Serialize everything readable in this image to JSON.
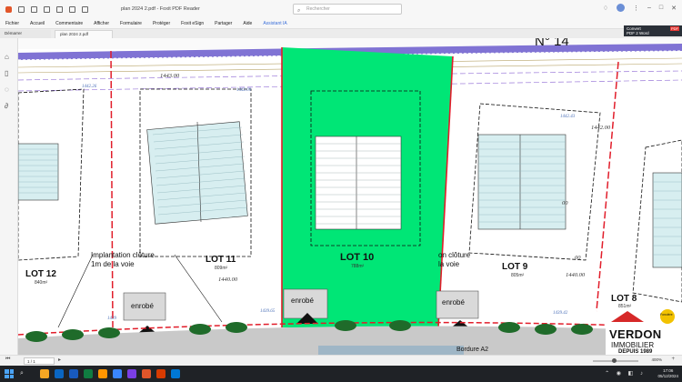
{
  "titlebar": {
    "title": "plan 2024 2.pdf - Foxit PDF Reader",
    "search_placeholder": "Rechercher"
  },
  "menu": [
    "Fichier",
    "Accueil",
    "Commentaire",
    "Afficher",
    "Formulaire",
    "Protéger",
    "Foxit eSign",
    "Partager",
    "Aide",
    "Assistant IA"
  ],
  "tabs": {
    "home": "Démarrer",
    "active": "plan 2024 2.pdf"
  },
  "convert_badge": {
    "line1": "Convert",
    "line2": "PDF 2 Word",
    "tag": "PDF"
  },
  "plan": {
    "street_number": "N° 14",
    "lots": [
      {
        "name": "LOT 12",
        "area": "840m²"
      },
      {
        "name": "LOT 11",
        "area": "809m²"
      },
      {
        "name": "LOT 10",
        "area": "788m²"
      },
      {
        "name": "LOT 9",
        "area": "805m²"
      },
      {
        "name": "LOT 8",
        "area": "851m²"
      }
    ],
    "fence_note_left_1": "Implantation clôture",
    "fence_note_left_2": "1m de la voie",
    "fence_note_right_1": "on clôture",
    "fence_note_right_2": "la voie",
    "enrobe": "enrobé",
    "bordure": "Bordure A2",
    "elevations": {
      "e1443_top": "1443.00",
      "e1442_right": "1442.00",
      "e1440_left": "1440.00",
      "e1440_right": "1440.00",
      "e1442_26": "1442.26",
      "e1442_09": "1442.09",
      "e1442_43": "1442.43",
      "e1439_65": "1439.65",
      "e1439_42": "1439.42",
      "e1439_l": "1439",
      "e00_a": "00",
      "e00_b": "00"
    },
    "brand": {
      "name_1": "VERDON",
      "name_2": "IMMOBILIER",
      "tag": "DEPUIS 1989",
      "logo_text": "Foncière"
    }
  },
  "statusbar": {
    "page": "1 / 1",
    "zoom": "400%"
  },
  "taskbar": {
    "time": "17:06",
    "date": "05/12/2024"
  },
  "colors": {
    "lot10_fill": "#00e676",
    "lot_border": "#e11d2a",
    "road_band": "#6a5acd",
    "accent_link": "#3b6fd9"
  }
}
